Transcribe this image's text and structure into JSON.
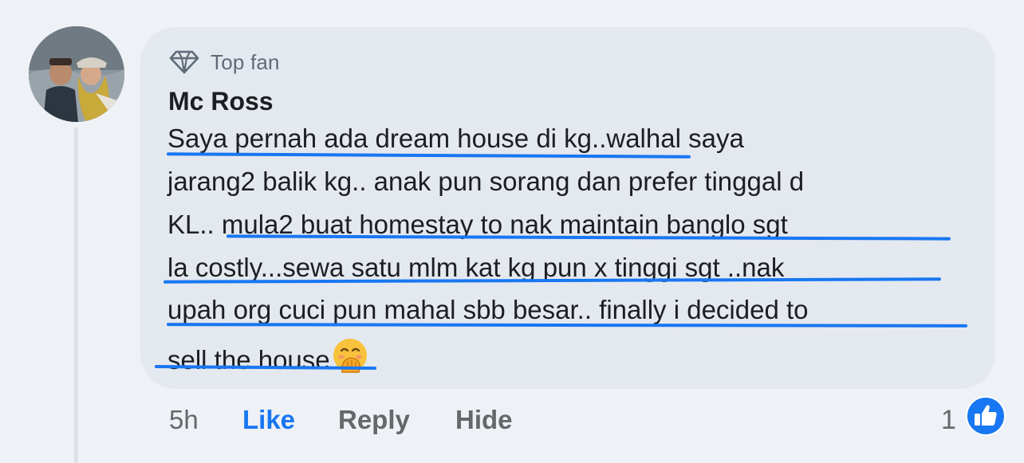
{
  "comment": {
    "badge": {
      "icon": "diamond-icon",
      "label": "Top fan"
    },
    "author": "Mc Ross",
    "text_lines": [
      "Saya pernah ada dream house di kg..walhal saya",
      "jarang2 balik kg.. anak pun sorang dan prefer tinggal d",
      "KL.. mula2 buat homestay to nak maintain banglo sgt",
      "la costly...sewa satu mlm kat kg pun x tinggi sgt ..nak",
      "upah org cuci pun mahal sbb besar.. finally i decided to",
      "sell the house"
    ],
    "trailing_emoji": "face-with-hand-over-mouth-emoji"
  },
  "actions": {
    "time": "5h",
    "like": "Like",
    "reply": "Reply",
    "hide": "Hide"
  },
  "reactions": {
    "count": "1",
    "icon": "thumbs-up-icon"
  },
  "colors": {
    "background": "#eef1f6",
    "bubble": "#e4e8ef",
    "accent": "#1877f2",
    "text": "#1c1e21",
    "muted": "#65676b"
  }
}
